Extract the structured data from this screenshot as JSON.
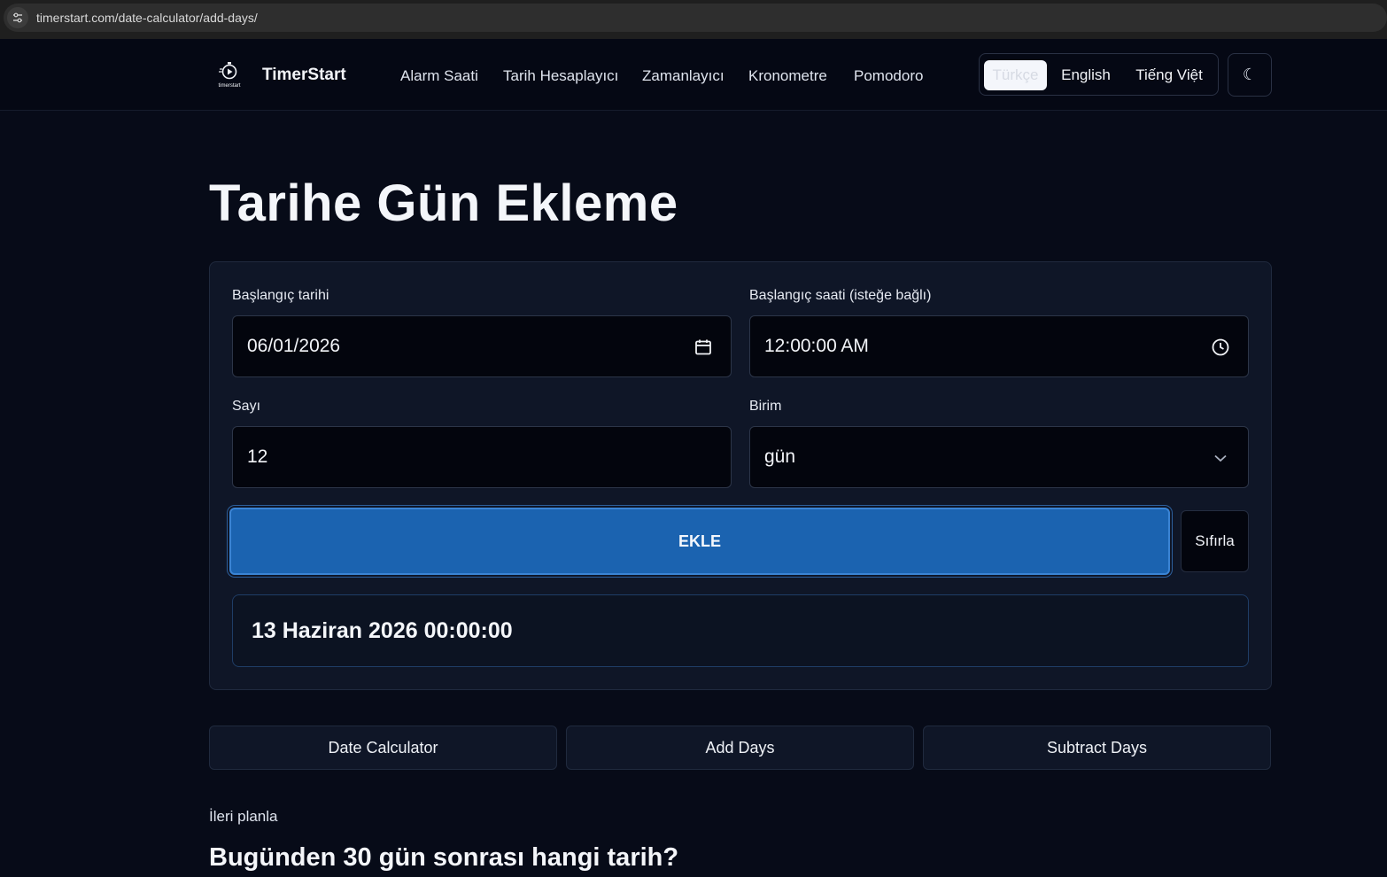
{
  "browser": {
    "url": "timerstart.com/date-calculator/add-days/"
  },
  "navbar": {
    "brand": "TimerStart",
    "logo_text": "timerstart",
    "links": [
      "Alarm Saati",
      "Tarih Hesaplayıcı",
      "Zamanlayıcı",
      "Kronometre",
      "Pomodoro"
    ],
    "languages": [
      {
        "label": "Türkçe",
        "active": true
      },
      {
        "label": "English",
        "active": false
      },
      {
        "label": "Tiếng Việt",
        "active": false
      }
    ],
    "theme_toggle": "☾"
  },
  "page": {
    "title": "Tarihe Gün Ekleme"
  },
  "form": {
    "start_date_label": "Başlangıç tarihi",
    "start_date_value": "06/01/2026",
    "start_time_label": "Başlangıç saati (isteğe bağlı)",
    "start_time_value": "12:00:00 AM",
    "amount_label": "Sayı",
    "amount_value": "12",
    "unit_label": "Birim",
    "unit_value": "gün",
    "add_button": "EKLE",
    "reset_button": "Sıfırla",
    "result": "13 Haziran 2026 00:00:00"
  },
  "sub_links": [
    "Date Calculator",
    "Add Days",
    "Subtract Days"
  ],
  "section": {
    "eyebrow": "İleri planla",
    "heading": "Bugünden 30 gün sonrası hangi tarih?"
  },
  "colors": {
    "background": "#070b18",
    "card": "#0f1627",
    "accent": "#1b63b0"
  }
}
